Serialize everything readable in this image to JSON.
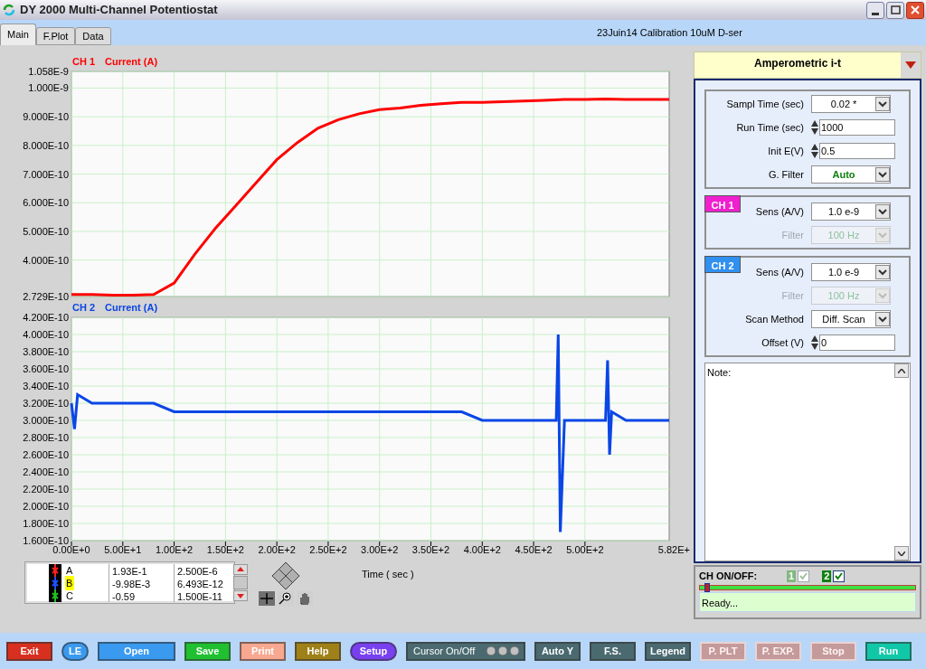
{
  "window": {
    "title": "DY 2000 Multi-Channel Potentiostat"
  },
  "tabs": [
    {
      "label": "Main",
      "selected": true
    },
    {
      "label": "F.Plot",
      "selected": false
    },
    {
      "label": "Data",
      "selected": false
    }
  ],
  "header_text": "23Juin14 Calibration 10uM D-ser",
  "charts": [
    {
      "chart_data": {
        "type": "line",
        "ylabel": "Current (A)",
        "grid": true,
        "x": [
          0,
          20,
          40,
          60,
          80,
          100,
          120,
          140,
          160,
          180,
          200,
          220,
          240,
          260,
          280,
          300,
          320,
          340,
          360,
          380,
          400,
          420,
          440,
          460,
          480,
          500,
          520,
          540,
          560,
          580,
          582
        ],
        "series": [
          {
            "name": "CH 1",
            "color": "#ff0000",
            "values": [
              2.8e-10,
              2.8e-10,
              2.78e-10,
              2.78e-10,
              2.8e-10,
              3.2e-10,
              4.2e-10,
              5.1e-10,
              5.9e-10,
              6.7e-10,
              7.5e-10,
              8.1e-10,
              8.6e-10,
              8.9e-10,
              9.1e-10,
              9.25e-10,
              9.3e-10,
              9.4e-10,
              9.45e-10,
              9.5e-10,
              9.5e-10,
              9.52e-10,
              9.55e-10,
              9.57e-10,
              9.6e-10,
              9.6e-10,
              9.62e-10,
              9.6e-10,
              9.6e-10,
              9.6e-10,
              9.6e-10
            ]
          }
        ],
        "xlim": [
          0,
          582
        ],
        "ylim": [
          2.729e-10,
          1.058e-09
        ],
        "yticks": [
          {
            "value": 2.729e-10,
            "label": "2.729E-10"
          },
          {
            "value": 4e-10,
            "label": "4.000E-10"
          },
          {
            "value": 5e-10,
            "label": "5.000E-10"
          },
          {
            "value": 6e-10,
            "label": "6.000E-10"
          },
          {
            "value": 7e-10,
            "label": "7.000E-10"
          },
          {
            "value": 8e-10,
            "label": "8.000E-10"
          },
          {
            "value": 9e-10,
            "label": "9.000E-10"
          },
          {
            "value": 1e-09,
            "label": "1.000E-9"
          },
          {
            "value": 1.058e-09,
            "label": "1.058E-9"
          }
        ]
      }
    },
    {
      "x_end_label": "5.82E+",
      "chart_data": {
        "type": "line",
        "xlabel": "Time ( sec )",
        "ylabel": "Current (A)",
        "grid": true,
        "x": [
          0,
          3,
          6,
          20,
          40,
          60,
          80,
          100,
          120,
          140,
          160,
          180,
          200,
          220,
          240,
          260,
          280,
          300,
          320,
          340,
          360,
          380,
          400,
          420,
          440,
          460,
          472,
          474,
          476,
          480,
          500,
          520,
          522,
          524,
          526,
          540,
          560,
          582
        ],
        "series": [
          {
            "name": "CH 2",
            "color": "#0a46e6",
            "values": [
              3.2e-10,
              2.9e-10,
              3.3e-10,
              3.2e-10,
              3.2e-10,
              3.2e-10,
              3.2e-10,
              3.1e-10,
              3.1e-10,
              3.1e-10,
              3.1e-10,
              3.1e-10,
              3.1e-10,
              3.1e-10,
              3.1e-10,
              3.1e-10,
              3.1e-10,
              3.1e-10,
              3.1e-10,
              3.1e-10,
              3.1e-10,
              3.1e-10,
              3e-10,
              3e-10,
              3e-10,
              3e-10,
              3e-10,
              4e-10,
              1.7e-10,
              3e-10,
              3e-10,
              3e-10,
              3.7e-10,
              2.6e-10,
              3.1e-10,
              3e-10,
              3e-10,
              3e-10
            ]
          }
        ],
        "xlim": [
          0,
          582
        ],
        "ylim": [
          1.6e-10,
          4.2e-10
        ],
        "xticks": [
          {
            "value": 0,
            "label": "0.00E+0"
          },
          {
            "value": 50,
            "label": "5.00E+1"
          },
          {
            "value": 100,
            "label": "1.00E+2"
          },
          {
            "value": 150,
            "label": "1.50E+2"
          },
          {
            "value": 200,
            "label": "2.00E+2"
          },
          {
            "value": 250,
            "label": "2.50E+2"
          },
          {
            "value": 300,
            "label": "3.00E+2"
          },
          {
            "value": 350,
            "label": "3.50E+2"
          },
          {
            "value": 400,
            "label": "4.00E+2"
          },
          {
            "value": 450,
            "label": "4.50E+2"
          },
          {
            "value": 500,
            "label": "5.00E+2"
          }
        ],
        "yticks": [
          {
            "value": 1.6e-10,
            "label": "1.600E-10"
          },
          {
            "value": 1.8e-10,
            "label": "1.800E-10"
          },
          {
            "value": 2e-10,
            "label": "2.000E-10"
          },
          {
            "value": 2.2e-10,
            "label": "2.200E-10"
          },
          {
            "value": 2.4e-10,
            "label": "2.400E-10"
          },
          {
            "value": 2.6e-10,
            "label": "2.600E-10"
          },
          {
            "value": 2.8e-10,
            "label": "2.800E-10"
          },
          {
            "value": 3e-10,
            "label": "3.000E-10"
          },
          {
            "value": 3.2e-10,
            "label": "3.200E-10"
          },
          {
            "value": 3.4e-10,
            "label": "3.400E-10"
          },
          {
            "value": 3.6e-10,
            "label": "3.600E-10"
          },
          {
            "value": 3.8e-10,
            "label": "3.800E-10"
          },
          {
            "value": 4e-10,
            "label": "4.000E-10"
          },
          {
            "value": 4.2e-10,
            "label": "4.200E-10"
          }
        ]
      }
    }
  ],
  "cursor_legend": [
    {
      "name": "A",
      "color": "#ff2020",
      "value_1": "1.93E-1",
      "value_2": "2.500E-6",
      "selected": false
    },
    {
      "name": "B",
      "color": "#2050ff",
      "value_1": "-9.98E-3",
      "value_2": "6.493E-12",
      "selected": true
    },
    {
      "name": "C",
      "color": "#20c020",
      "value_1": "-0.59",
      "value_2": "1.500E-11",
      "selected": false
    }
  ],
  "settings": {
    "mode": "Amperometric i-t",
    "groups": [
      {
        "rows": [
          {
            "kind": "select",
            "label": "Sampl Time (sec)",
            "value": "0.02 *",
            "disabled": false,
            "emphasis": false
          },
          {
            "kind": "spin",
            "label": "Run Time (sec)",
            "value": "1000",
            "disabled": false
          },
          {
            "kind": "spin",
            "label": "Init E(V)",
            "value": "0.5",
            "disabled": false
          },
          {
            "kind": "select",
            "label": "G. Filter",
            "value": "Auto",
            "disabled": false,
            "emphasis": true
          }
        ]
      },
      {
        "tag": "CH 1",
        "color": "#f020d0",
        "rows": [
          {
            "kind": "select",
            "label": "Sens (A/V)",
            "value": "1.0 e-9",
            "disabled": false,
            "emphasis": false
          },
          {
            "kind": "select",
            "label": "Filter",
            "value": "100 Hz",
            "disabled": true
          }
        ]
      },
      {
        "tag": "CH 2",
        "color": "#3090f0",
        "rows": [
          {
            "kind": "select",
            "label": "Sens (A/V)",
            "value": "1.0 e-9",
            "disabled": false,
            "emphasis": false
          },
          {
            "kind": "select",
            "label": "Filter",
            "value": "100 Hz",
            "disabled": true
          },
          {
            "kind": "select",
            "label": "Scan Method",
            "value": "Diff. Scan",
            "disabled": false,
            "emphasis": false
          },
          {
            "kind": "spin",
            "label": "Offset (V)",
            "value": "0",
            "disabled": false
          }
        ]
      }
    ],
    "note": "Note:"
  },
  "ch_on_off": {
    "label": "CH ON/OFF:",
    "channels": [
      {
        "label": "1",
        "checked": true,
        "disabled": true
      },
      {
        "label": "2",
        "checked": true,
        "disabled": false
      }
    ],
    "progress": {
      "level": 0.02
    },
    "status": "Ready..."
  },
  "buttons": [
    {
      "label": "Exit",
      "color": "#d83020",
      "kind": "rect",
      "disabled": false
    },
    {
      "label": "LE",
      "color": "#3a9af0",
      "kind": "oval",
      "disabled": false
    },
    {
      "label": "Open",
      "color": "#3a9af0",
      "kind": "rect",
      "disabled": false
    },
    {
      "label": "Save",
      "color": "#20c030",
      "kind": "rect",
      "disabled": false
    },
    {
      "label": "Print",
      "color": "#f8a890",
      "kind": "rect",
      "disabled": false
    },
    {
      "label": "Help",
      "color": "#a08018",
      "kind": "rect",
      "disabled": false
    },
    {
      "label": "Setup",
      "color": "#7840f0",
      "kind": "oval",
      "disabled": false
    },
    {
      "label": "Cursor On/Off",
      "color": "#4a6a70",
      "kind": "leds",
      "disabled": false
    },
    {
      "label": "Auto Y",
      "color": "#4a6a70",
      "kind": "rect",
      "disabled": false
    },
    {
      "label": "F.S.",
      "color": "#4a6a70",
      "kind": "rect",
      "disabled": false
    },
    {
      "label": "Legend",
      "color": "#4a6a70",
      "kind": "rect",
      "disabled": false
    },
    {
      "label": "P. PLT",
      "color": "#c49a9a",
      "kind": "rect",
      "disabled": true
    },
    {
      "label": "P. EXP.",
      "color": "#c49a9a",
      "kind": "rect",
      "disabled": true
    },
    {
      "label": "Stop",
      "color": "#c49a9a",
      "kind": "rect",
      "disabled": true
    },
    {
      "label": "Run",
      "color": "#10c8a8",
      "kind": "rect",
      "disabled": false
    }
  ]
}
